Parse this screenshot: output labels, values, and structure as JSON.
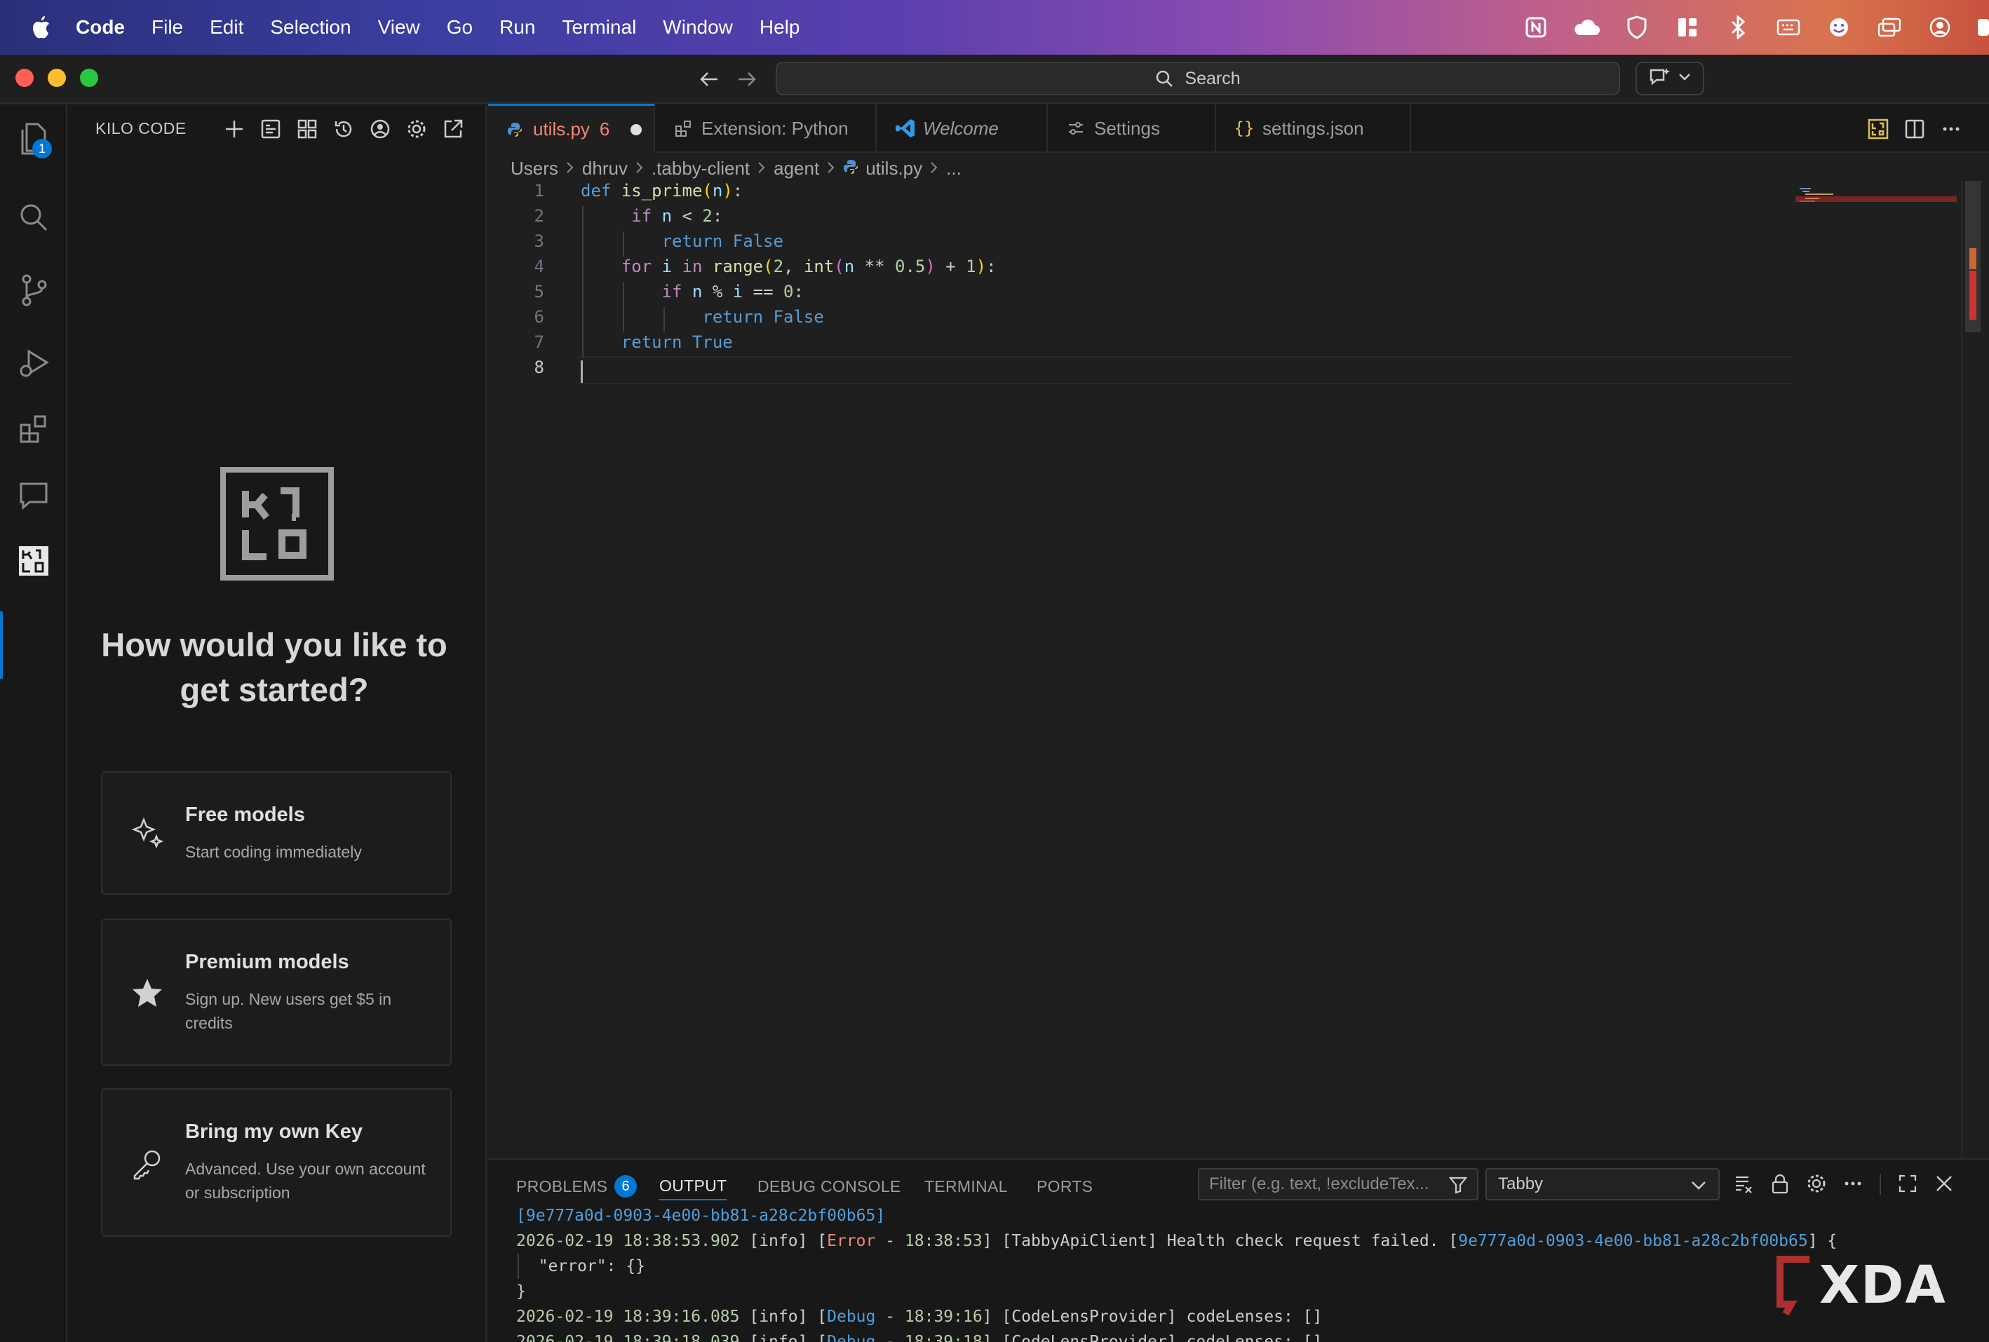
{
  "menubar": {
    "app": "Code",
    "items": [
      "File",
      "Edit",
      "Selection",
      "View",
      "Go",
      "Run",
      "Terminal",
      "Window",
      "Help"
    ]
  },
  "titlebar": {
    "search_label": "Search"
  },
  "activity": {
    "explorer_badge": "1"
  },
  "sidepanel": {
    "title": "KILO CODE",
    "heading": "How would you like to get started?",
    "cards": [
      {
        "title": "Free models",
        "desc": "Start coding immediately",
        "icon": "sparkles-icon"
      },
      {
        "title": "Premium models",
        "desc": "Sign up. New users get $5 in credits",
        "icon": "star-icon"
      },
      {
        "title": "Bring my own Key",
        "desc": "Advanced. Use your own account or subscription",
        "icon": "key-icon"
      }
    ]
  },
  "tabs": {
    "utils": {
      "label": "utils.py",
      "count": "6"
    },
    "ext": "Extension: Python",
    "welcome": "Welcome",
    "settings": "Settings",
    "json": "settings.json"
  },
  "breadcrumb": [
    "Users",
    "dhruv",
    ".tabby-client",
    "agent",
    "utils.py",
    "..."
  ],
  "editor": {
    "line_numbers": [
      "1",
      "2",
      "3",
      "4",
      "5",
      "6",
      "7",
      "8"
    ],
    "lines": [
      "def is_prime(n):",
      "     if n < 2:",
      "        return False",
      "    for i in range(2, int(n ** 0.5) + 1):",
      "        if n % i == 0:",
      "            return False",
      "    return True",
      ""
    ]
  },
  "panel": {
    "tabs": {
      "problems": "PROBLEMS",
      "problems_count": "6",
      "output": "OUTPUT",
      "debug": "DEBUG CONSOLE",
      "terminal": "TERMINAL",
      "ports": "PORTS"
    },
    "filter_placeholder": "Filter (e.g. text, !excludeTex...",
    "channel": "Tabby",
    "output": {
      "l1_id": "[9e777a0d-0903-4e00-bb81-a28c2bf00b65]",
      "l2_date": "2026-02-19 18:38:53.902",
      "l2_a": " [info] [",
      "l2_level": "Error",
      "l2_b": " - ",
      "l2_time": "18:38:53",
      "l2_c": "] [TabbyApiClient] Health check request failed. [",
      "l2_id": "9e777a0d-0903-4e00-bb81-a28c2bf00b65",
      "l2_d": "] {",
      "l3": "  \"error\": {}",
      "l4": "}",
      "l5_date": "2026-02-19 18:39:16.085",
      "l5_a": " [info] [",
      "l5_level": "Debug",
      "l5_b": " - ",
      "l5_time": "18:39:16",
      "l5_c": "] [CodeLensProvider] codeLenses: []",
      "l6_date": "2026-02-19 18:39:18.039",
      "l6_a": " [info] [",
      "l6_level": "Debug",
      "l6_b": " - ",
      "l6_time": "18:39:18",
      "l6_c": "] [CodeLensProvider] codeLenses: []"
    }
  },
  "watermark": "XDA"
}
